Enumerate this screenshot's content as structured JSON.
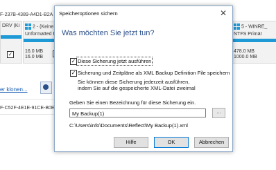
{
  "background": {
    "header_id_left": "F-237B-4389-A4D1-B2A",
    "partition1": {
      "label": "DRV (Ki",
      "used": "",
      "size": ""
    },
    "partition2": {
      "label": "2 - (Keine",
      "fs": "Unformatted P",
      "used": "16.0 MB",
      "total": "16.0 MB"
    },
    "partition3": {
      "label": "5 - WINRE_",
      "fs": "NTFS Primär",
      "used": "478.0 MB",
      "total": "1000.0 MB"
    },
    "link_text": "er klonen...",
    "footer_id": "F-C52F-4E1E-91CE-B0E8"
  },
  "dialog": {
    "title": "Speicheroptionen sichern",
    "close_glyph": "✕",
    "heading": "Was möchten Sie jetzt tun?",
    "run_now_label": "Diese Sicherung jetzt ausführen",
    "run_now_checked": true,
    "save_xml_label": "Sicherung und Zeitpläne als XML Backup Definition File speichern",
    "save_xml_checked": true,
    "info_line1": "Sie können diese Sicherung jederzeit ausführen,",
    "info_line2": "indem Sie auf die gespeicherte XML-Datei zweimal",
    "name_prompt": "Geben Sie einen Bezeichnung für diese Sicherung ein.",
    "name_value": "My Backup(1)",
    "browse_label": "...",
    "path": "C:\\Users\\info\\Documents\\Reflect\\My Backup(1).xml",
    "buttons": {
      "help": "Hilfe",
      "ok": "OK",
      "cancel": "Abbrechen"
    }
  },
  "colors": {
    "accent": "#1e9ad6",
    "heading": "#2b4f8a",
    "link": "#1a5fb4"
  }
}
